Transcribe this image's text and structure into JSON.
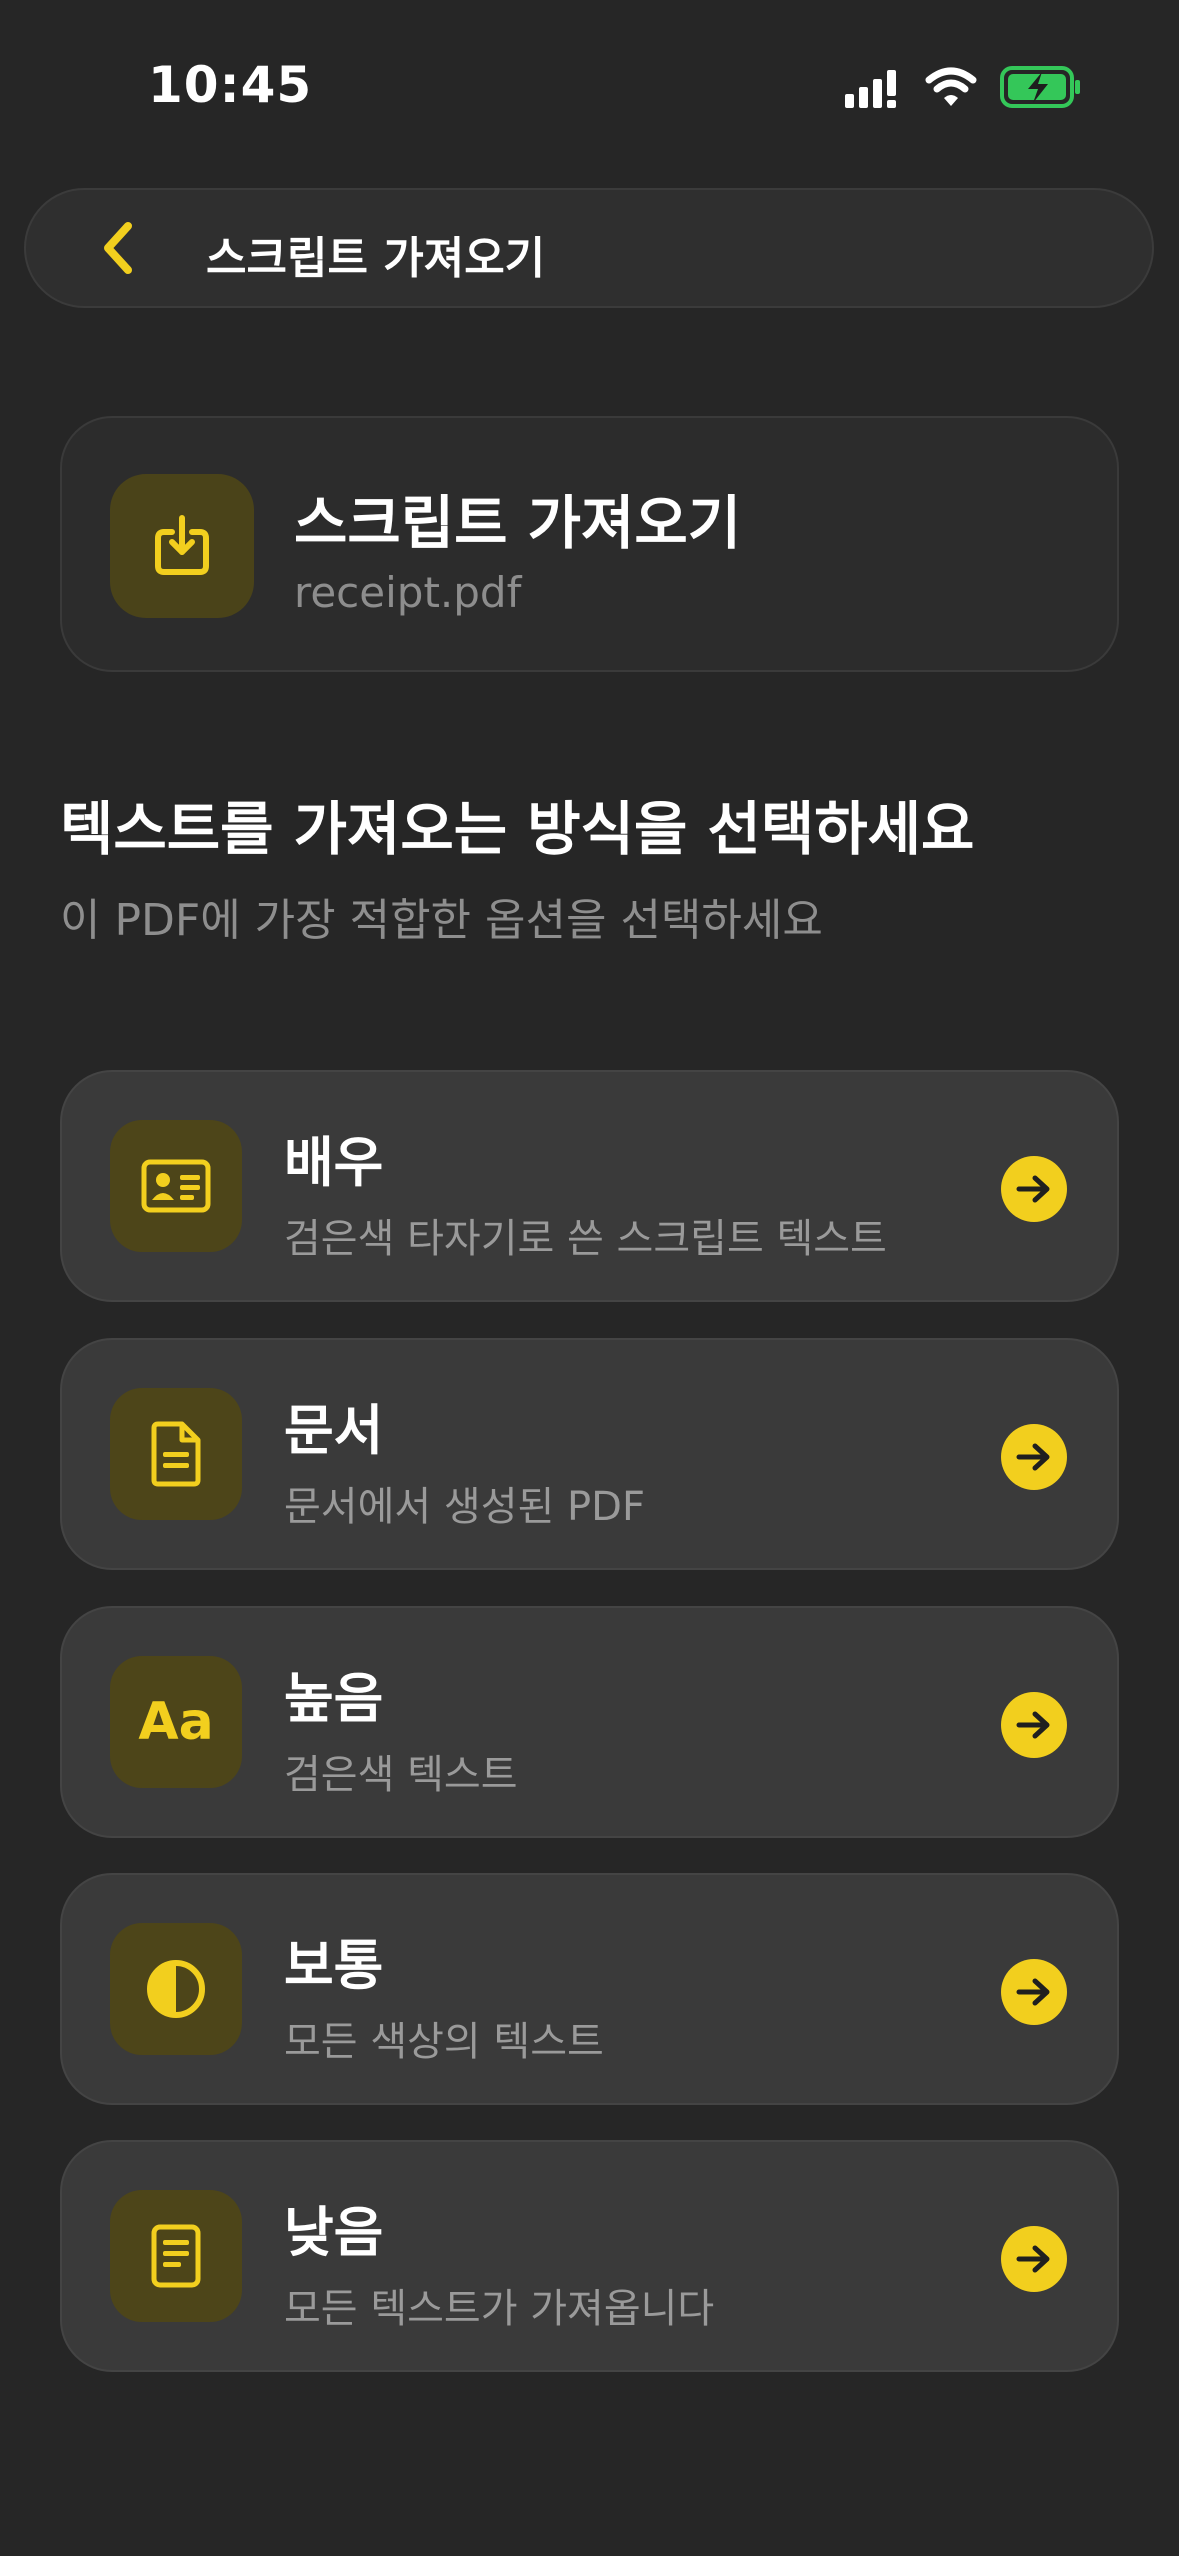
{
  "status_bar": {
    "time": "10:45"
  },
  "nav": {
    "title": "스크립트 가져오기",
    "back_icon": "chevron-left-icon"
  },
  "file_card": {
    "title": "스크립트 가져오기",
    "filename": "receipt.pdf",
    "icon": "import-icon"
  },
  "section": {
    "title": "텍스트를 가져오는 방식을 선택하세요",
    "subtitle": "이 PDF에 가장 적합한 옵션을 선택하세요"
  },
  "options": [
    {
      "title": "배우",
      "subtitle": "검은색 타자기로 쓴 스크립트 텍스트",
      "icon": "id-card-icon"
    },
    {
      "title": "문서",
      "subtitle": "문서에서 생성된 PDF",
      "icon": "document-icon"
    },
    {
      "title": "높음",
      "subtitle": "검은색 텍스트",
      "icon": "text-size-icon",
      "icon_text": "Aa"
    },
    {
      "title": "보통",
      "subtitle": "모든 색상의 텍스트",
      "icon": "contrast-icon"
    },
    {
      "title": "낮음",
      "subtitle": "모든 텍스트가 가져옵니다",
      "icon": "note-icon"
    }
  ],
  "colors": {
    "accent": "#f2cf1e",
    "background": "#262626",
    "card": "#3a3a3a",
    "icon_bg": "#4d4519",
    "battery": "#34c759"
  }
}
